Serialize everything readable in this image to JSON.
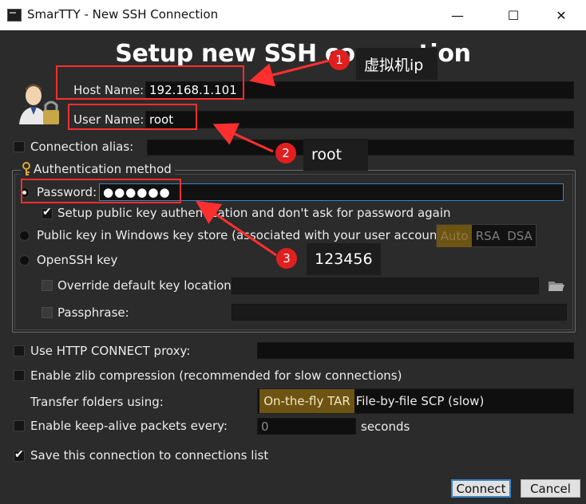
{
  "window": {
    "title": "SmarTTY - New SSH Connection",
    "minimize": "—",
    "maximize": "☐",
    "close": "✕"
  },
  "heading": "Setup new SSH connection",
  "host": {
    "label": "Host Name:",
    "value": "192.168.1.101"
  },
  "user": {
    "label": "User Name:",
    "value": "root"
  },
  "alias": {
    "label": "Connection alias:",
    "value": ""
  },
  "auth": {
    "title": "Authentication method",
    "password": {
      "label": "Password:",
      "value": "●●●●●●"
    },
    "setup_key": {
      "label": "Setup public key authentication and don't ask for password again",
      "checked": true
    },
    "pubkey": {
      "label": "Public key in Windows key store (associated with your user account):",
      "options": [
        "Auto",
        "RSA",
        "DSA"
      ],
      "selected": "Auto"
    },
    "openssh": {
      "label": "OpenSSH key"
    },
    "override": {
      "label": "Override default key location:"
    },
    "passphrase": {
      "label": "Passphrase:"
    }
  },
  "proxy": {
    "label": "Use HTTP CONNECT proxy:"
  },
  "zlib": {
    "label": "Enable zlib compression (recommended for slow connections)"
  },
  "transfer": {
    "label": "Transfer folders using:",
    "options": [
      "On-the-fly TAR",
      "File-by-file SCP (slow)"
    ],
    "selected": "On-the-fly TAR"
  },
  "keepalive": {
    "label": "Enable keep-alive packets every:",
    "value": "0",
    "unit": "seconds"
  },
  "save": {
    "label": "Save this connection to connections list",
    "checked": true
  },
  "buttons": {
    "connect": "Connect",
    "cancel": "Cancel"
  },
  "annotations": [
    {
      "number": "1",
      "text": "虚拟机ip"
    },
    {
      "number": "2",
      "text": "root"
    },
    {
      "number": "3",
      "text": "123456"
    }
  ],
  "colors": {
    "accent": "#3b84c4",
    "annotation": "#ff2f2f",
    "selected_segment": "#7a5c12"
  }
}
